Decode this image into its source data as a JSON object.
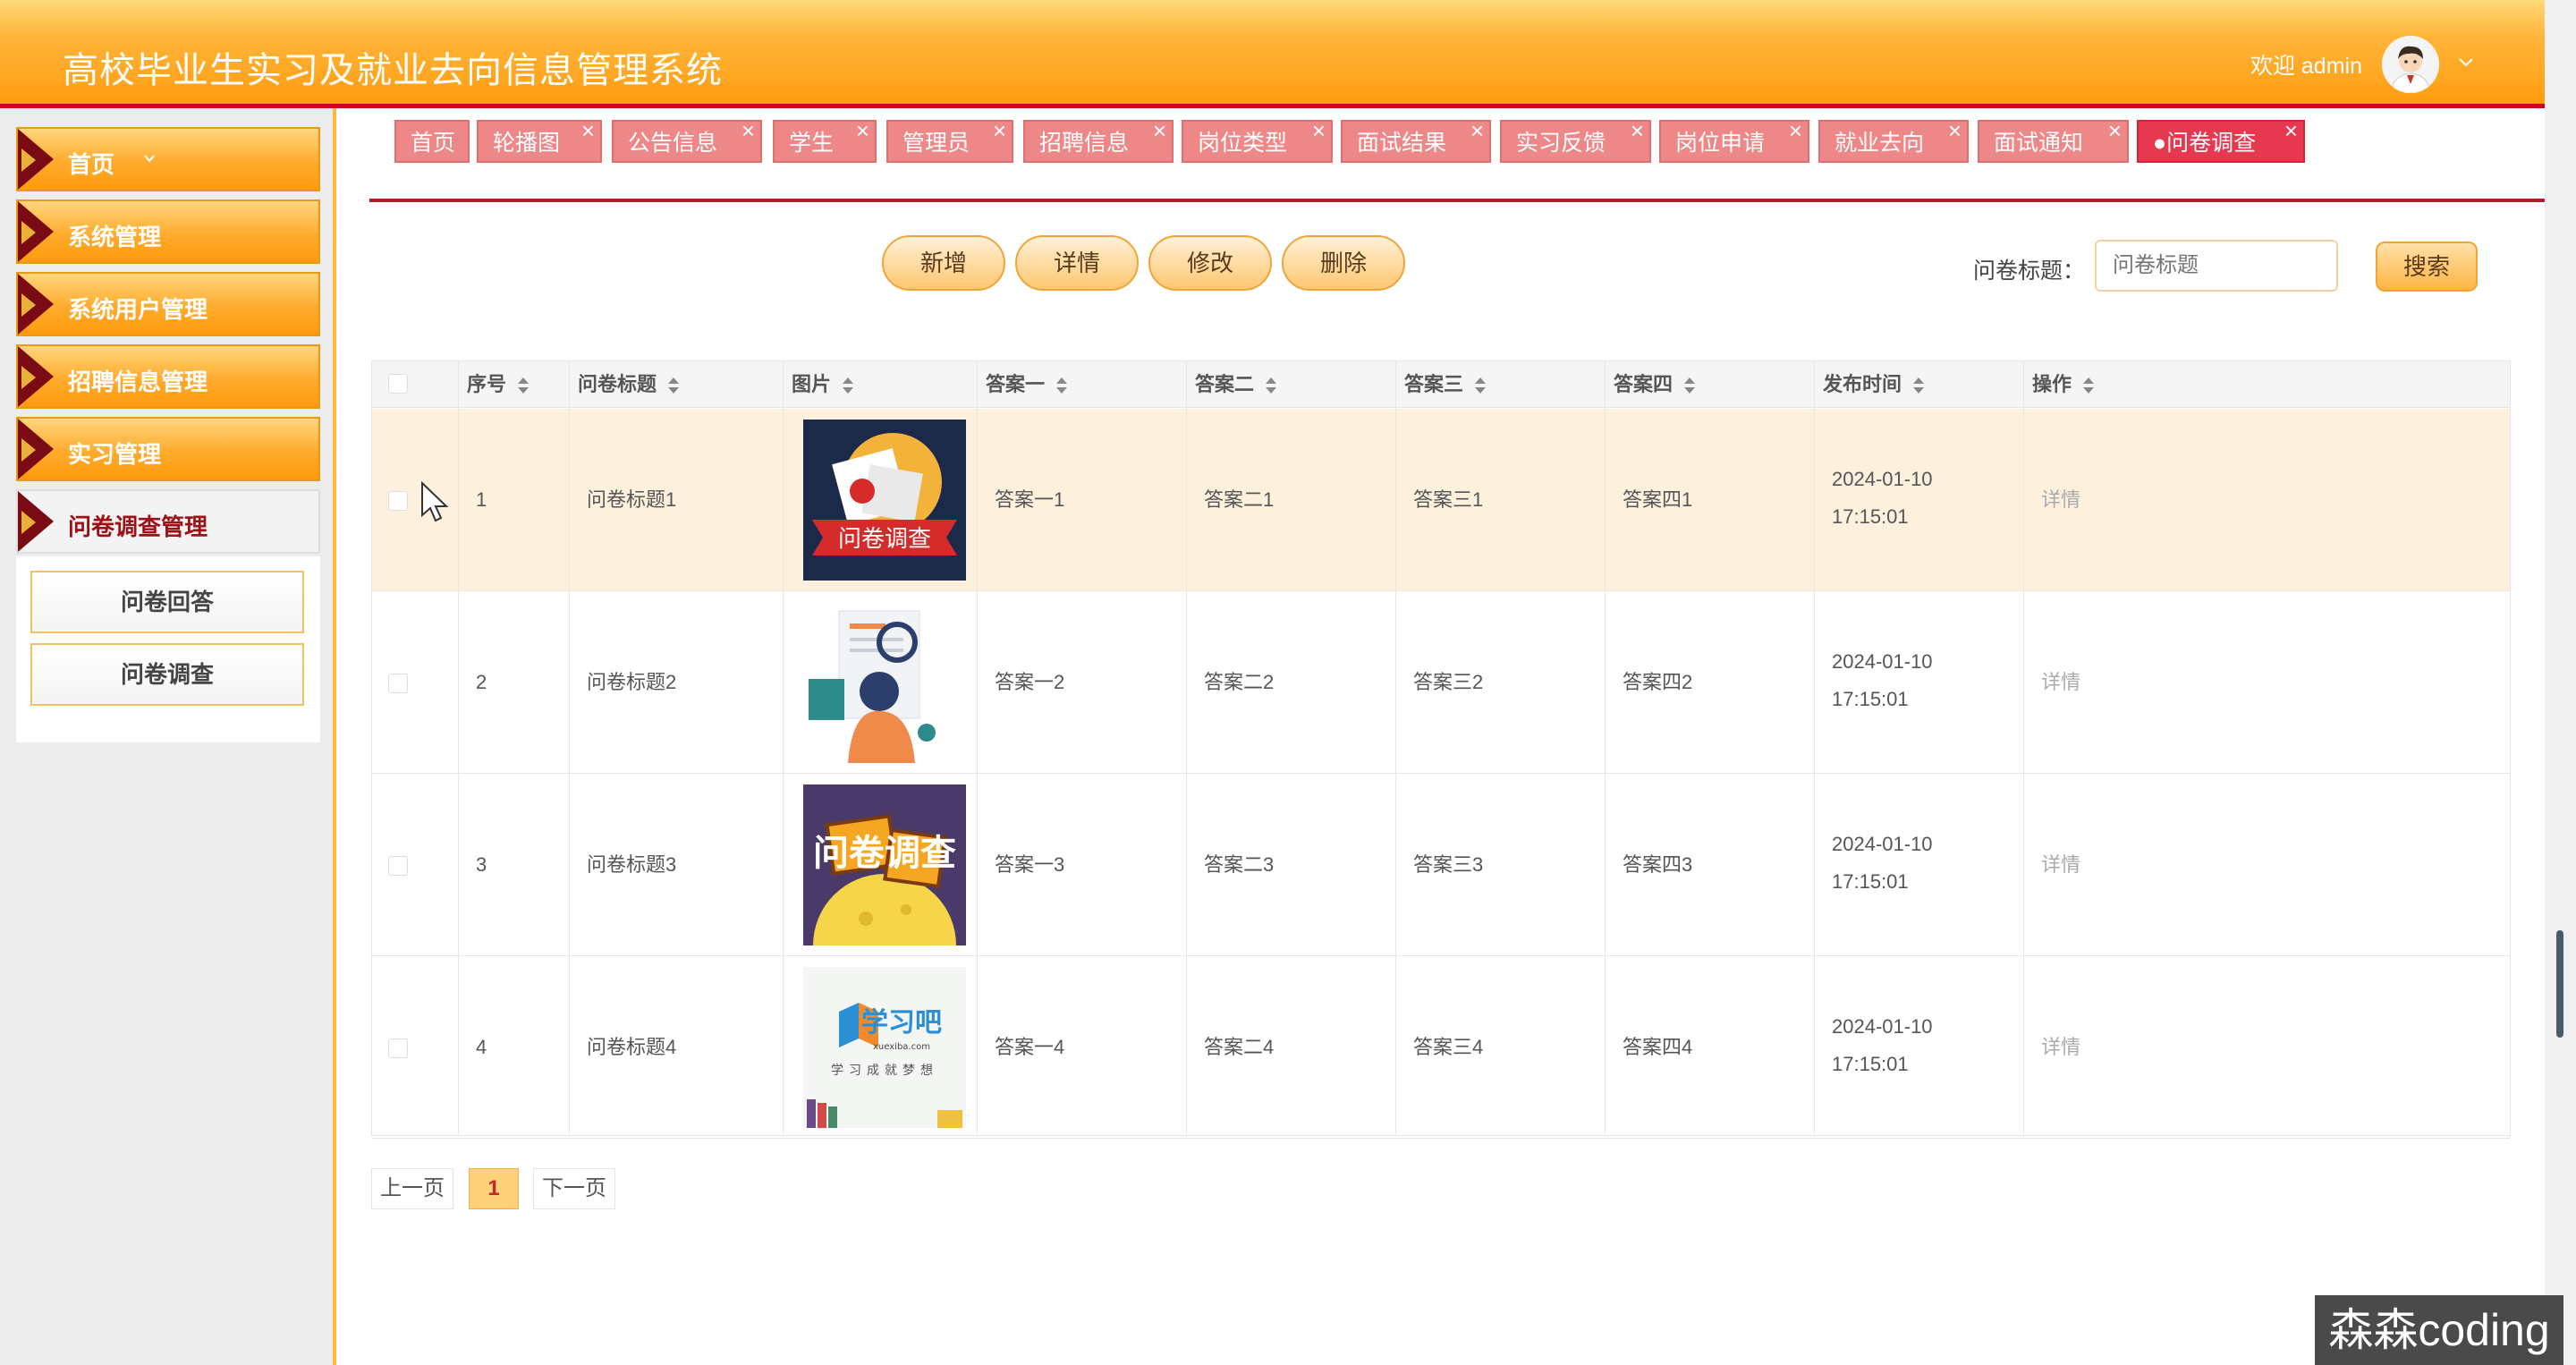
{
  "header": {
    "title": "高校毕业生实习及就业去向信息管理系统",
    "welcome": "欢迎 admin"
  },
  "sidebar": {
    "items": [
      {
        "label": "首页"
      },
      {
        "label": "系统管理"
      },
      {
        "label": "系统用户管理"
      },
      {
        "label": "招聘信息管理"
      },
      {
        "label": "实习管理"
      },
      {
        "label": "问卷调查管理"
      }
    ],
    "submenu": [
      {
        "label": "问卷回答"
      },
      {
        "label": "问卷调查"
      }
    ]
  },
  "tabs": [
    {
      "label": "首页"
    },
    {
      "label": "轮播图"
    },
    {
      "label": "公告信息"
    },
    {
      "label": "学生"
    },
    {
      "label": "管理员"
    },
    {
      "label": "招聘信息"
    },
    {
      "label": "岗位类型"
    },
    {
      "label": "面试结果"
    },
    {
      "label": "实习反馈"
    },
    {
      "label": "岗位申请"
    },
    {
      "label": "就业去向"
    },
    {
      "label": "面试通知"
    },
    {
      "label": "●问卷调查"
    }
  ],
  "toolbar": {
    "add": "新增",
    "detail": "详情",
    "edit": "修改",
    "delete": "删除",
    "search_label": "问卷标题：",
    "search_placeholder": "问卷标题",
    "search_button": "搜索"
  },
  "table": {
    "headers": [
      "序号",
      "问卷标题",
      "图片",
      "答案一",
      "答案二",
      "答案三",
      "答案四",
      "发布时间",
      "操作"
    ],
    "rows": [
      {
        "no": "1",
        "title": "问卷标题1",
        "a1": "答案一1",
        "a2": "答案二1",
        "a3": "答案三1",
        "a4": "答案四1",
        "time": "2024-01-10 17:15:01",
        "op": "详情",
        "image": "survey-banner-image"
      },
      {
        "no": "2",
        "title": "问卷标题2",
        "a1": "答案一2",
        "a2": "答案二2",
        "a3": "答案三2",
        "a4": "答案四2",
        "time": "2024-01-10 17:15:01",
        "op": "详情",
        "image": "person-reading-image"
      },
      {
        "no": "3",
        "title": "问卷标题3",
        "a1": "答案一3",
        "a2": "答案二3",
        "a3": "答案三3",
        "a4": "答案四3",
        "time": "2024-01-10 17:15:01",
        "op": "详情",
        "image": "survey-poster-image"
      },
      {
        "no": "4",
        "title": "问卷标题4",
        "a1": "答案一4",
        "a2": "答案二4",
        "a3": "答案三4",
        "a4": "答案四4",
        "time": "2024-01-10 17:15:01",
        "op": "详情",
        "image": "study-logo-image"
      }
    ],
    "thumb_texts": {
      "r1": "问卷调查",
      "r3": "问卷调查",
      "r4_logo": "学习吧",
      "r4_domain": "xuexiba.com",
      "r4_slogan": "学习成就梦想"
    }
  },
  "pager": {
    "prev": "上一页",
    "current": "1",
    "next": "下一页"
  },
  "watermark": "森森coding",
  "colors": {
    "header_orange": "#ff9c10",
    "accent_red": "#d3001f",
    "tab_pink": "#ee8888",
    "tab_active": "#e8384f",
    "row_highlight": "#fdf1de"
  }
}
